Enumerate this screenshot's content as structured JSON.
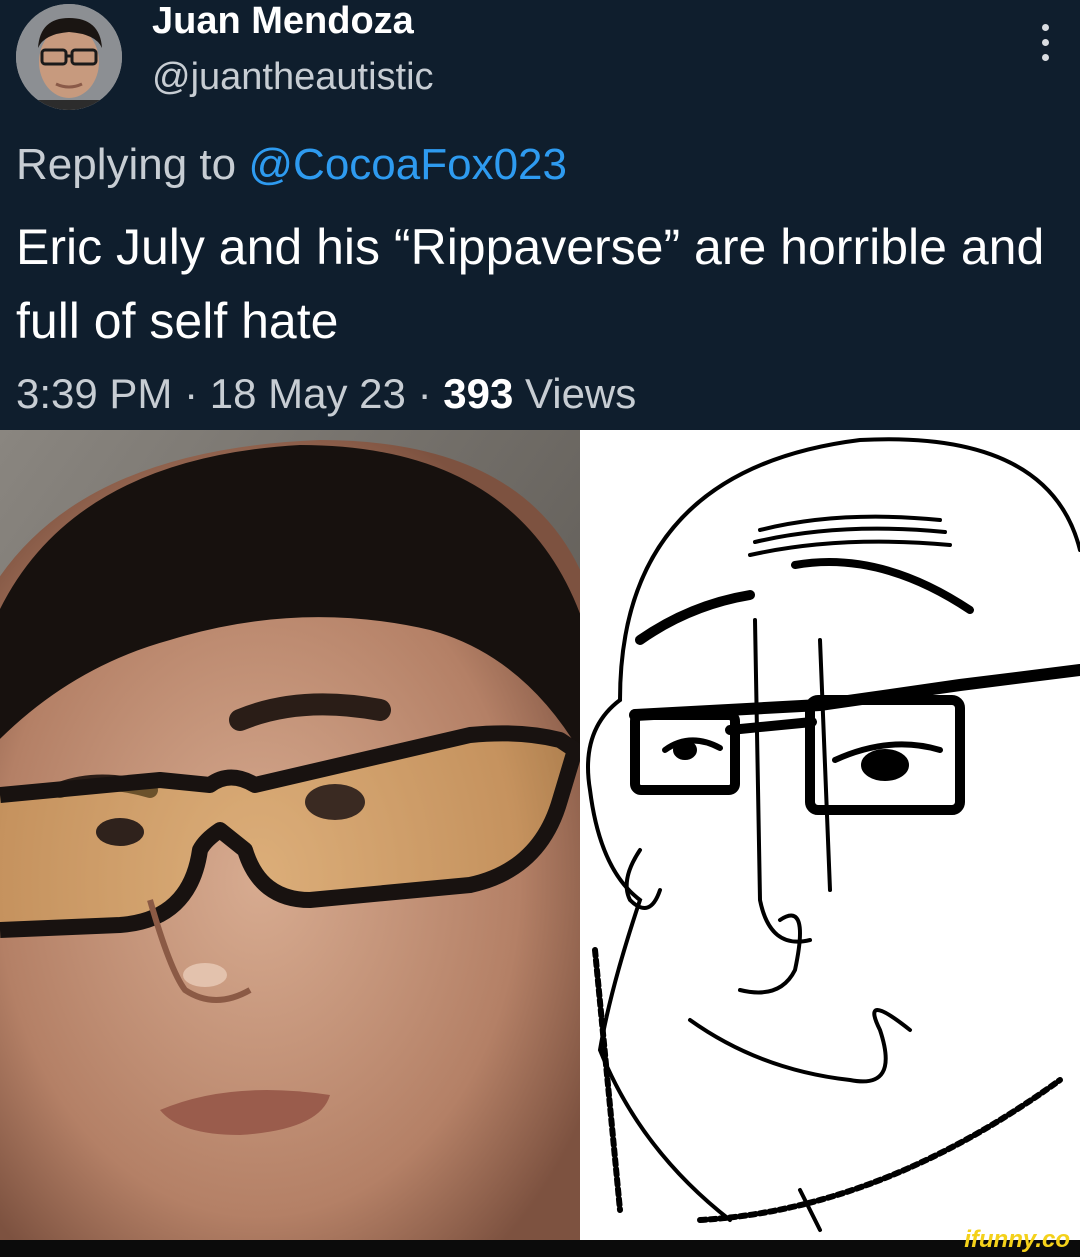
{
  "tweet": {
    "author_name": "Juan Mendoza",
    "author_handle": "@juantheautistic",
    "reply_prefix": "Replying to",
    "reply_mention": "@CocoaFox023",
    "text": "Eric July and his “Rippaverse” are horrible and full of self hate",
    "time": "3:39 PM",
    "separator": "·",
    "date": "18 May 23",
    "views_count": "393",
    "views_label": "Views",
    "more_icon": "more-vertical-icon",
    "colors": {
      "background": "#0f1e2d",
      "mention": "#2e9bf0",
      "muted": "#c7cdd3"
    }
  },
  "watermark": {
    "text": "ifunny.co",
    "color": "#f4d11a"
  }
}
